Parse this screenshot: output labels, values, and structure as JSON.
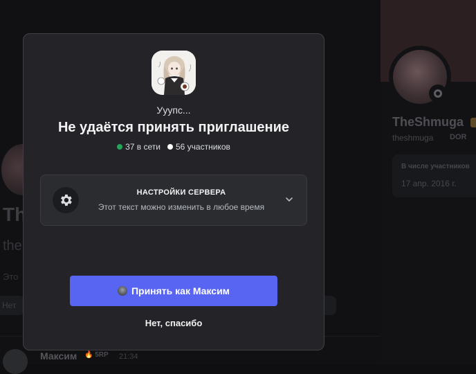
{
  "background": {
    "profile_right": {
      "name": "TheShmuga",
      "handle": "theshmuga",
      "tag": "DOR",
      "member_since_label": "В числе участников",
      "member_since_date": "17 апр. 2016 г."
    },
    "left": {
      "big_name": "Th",
      "handle": "the",
      "text": "Это",
      "pill": "Нет"
    },
    "message": {
      "author": "Максим",
      "badge": "5RP",
      "time": "21:34"
    }
  },
  "modal": {
    "subtitle": "Уyупс...",
    "title": "Не удаётся принять приглашение",
    "online": "37 в сети",
    "members": "56 участников",
    "settings": {
      "heading": "НАСТРОЙКИ СЕРВЕРА",
      "description": "Этот текст можно изменить в любое время",
      "icon": "gear-icon"
    },
    "accept_label": "Принять как Максим",
    "decline_label": "Нет, спасибо"
  },
  "colors": {
    "accent": "#5865f2",
    "online": "#23a55a",
    "modal_bg": "#242428"
  }
}
